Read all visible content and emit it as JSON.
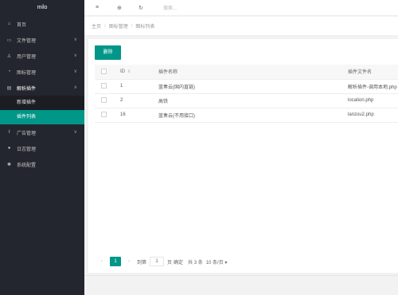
{
  "sidebar": {
    "logo": "milo",
    "items": [
      {
        "icon": "home-icon",
        "icon_glyph": "⌂",
        "label": "首页"
      },
      {
        "icon": "file-icon",
        "icon_glyph": "▭",
        "label": "文件管理",
        "chevron": "∨"
      },
      {
        "icon": "user-icon",
        "icon_glyph": "♙",
        "label": "用户管理",
        "chevron": "∨"
      },
      {
        "icon": "chart-icon",
        "icon_glyph": "◔",
        "label": "图标管理",
        "chevron": "∨"
      },
      {
        "icon": "plugin-icon",
        "icon_glyph": "▤",
        "label": "解析插件",
        "chevron": "∧"
      },
      {
        "icon": "ad-icon",
        "icon_glyph": "ℓ",
        "label": "广告管理",
        "chevron": "∨"
      },
      {
        "icon": "comment-icon",
        "icon_glyph": "●",
        "label": "日志管理"
      },
      {
        "icon": "settings-icon",
        "icon_glyph": "✺",
        "label": "系统配置"
      }
    ],
    "sub_items": [
      "新增插件",
      "插件列表"
    ]
  },
  "topbar": {
    "menu_icon": "≡",
    "globe_icon": "⊕",
    "refresh_icon": "↻",
    "search_placeholder": "搜索..."
  },
  "breadcrumb": [
    "主页",
    "图标管理",
    "图标列表"
  ],
  "breadcrumb_sep": "/",
  "toolbar": {
    "delete_label": "删除"
  },
  "table": {
    "columns": [
      "ID",
      "插件名称",
      "插件文件名"
    ],
    "sort_glyph": "⇕",
    "rows": [
      {
        "id": "1",
        "name": "蓝奏云(国内直链)",
        "file": "解析插件-调用本地,php"
      },
      {
        "id": "2",
        "name": "高铁",
        "file": "location.php"
      },
      {
        "id": "16",
        "name": "蓝奏云(不用接口)",
        "file": "lanzou2.php"
      }
    ]
  },
  "pagination": {
    "prev": "‹",
    "current": "1",
    "next": "›",
    "goto_label": "到第",
    "goto_value": "1",
    "page_unit": "页",
    "confirm_label": "确定",
    "total_label": "共 3 条",
    "page_size": "10 条/页 ▾"
  },
  "colors": {
    "accent": "#009688",
    "sidebar_bg": "#23262e"
  }
}
